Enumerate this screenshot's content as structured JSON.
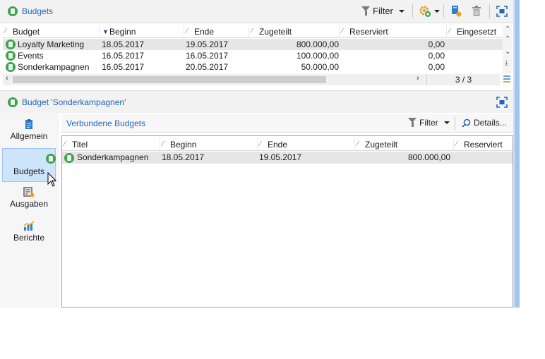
{
  "top_panel": {
    "title": "Budgets",
    "toolbar": {
      "filter_label": "Filter"
    },
    "columns": [
      "Budget",
      "Beginn",
      "Ende",
      "Zugeteilt",
      "Reserviert",
      "Eingesetzt"
    ],
    "rows": [
      {
        "name": "Loyalty Marketing",
        "begin": "18.05.2017",
        "end": "19.05.2017",
        "allocated": "800.000,00",
        "reserved": "0,00"
      },
      {
        "name": "Events",
        "begin": "16.05.2017",
        "end": "16.05.2017",
        "allocated": "100.000,00",
        "reserved": "0,00"
      },
      {
        "name": "Sonderkampagnen",
        "begin": "16.05.2017",
        "end": "20.05.2017",
        "allocated": "50.000,00",
        "reserved": "0,00"
      }
    ],
    "pager": "3 / 3"
  },
  "detail_panel": {
    "title": "Budget 'Sonderkampagnen'",
    "sidebar": [
      {
        "label": "Allgemein",
        "icon": "clipboard-icon"
      },
      {
        "label": "Budgets",
        "icon": "budget-icon"
      },
      {
        "label": "Ausgaben",
        "icon": "expenses-icon"
      },
      {
        "label": "Berichte",
        "icon": "chart-icon"
      }
    ],
    "sub_title": "Verbundene Budgets",
    "filter_label": "Filter",
    "details_label": "Details...",
    "columns": [
      "Titel",
      "Beginn",
      "Ende",
      "Zugeteilt",
      "Reserviert"
    ],
    "rows": [
      {
        "name": "Sonderkampagnen",
        "begin": "18.05.2017",
        "end": "19.05.2017",
        "allocated": "800.000,00"
      }
    ]
  },
  "colors": {
    "accent_blue": "#2167b8",
    "budget_green": "#3fa34d",
    "selection_blue": "#cde4fa"
  }
}
